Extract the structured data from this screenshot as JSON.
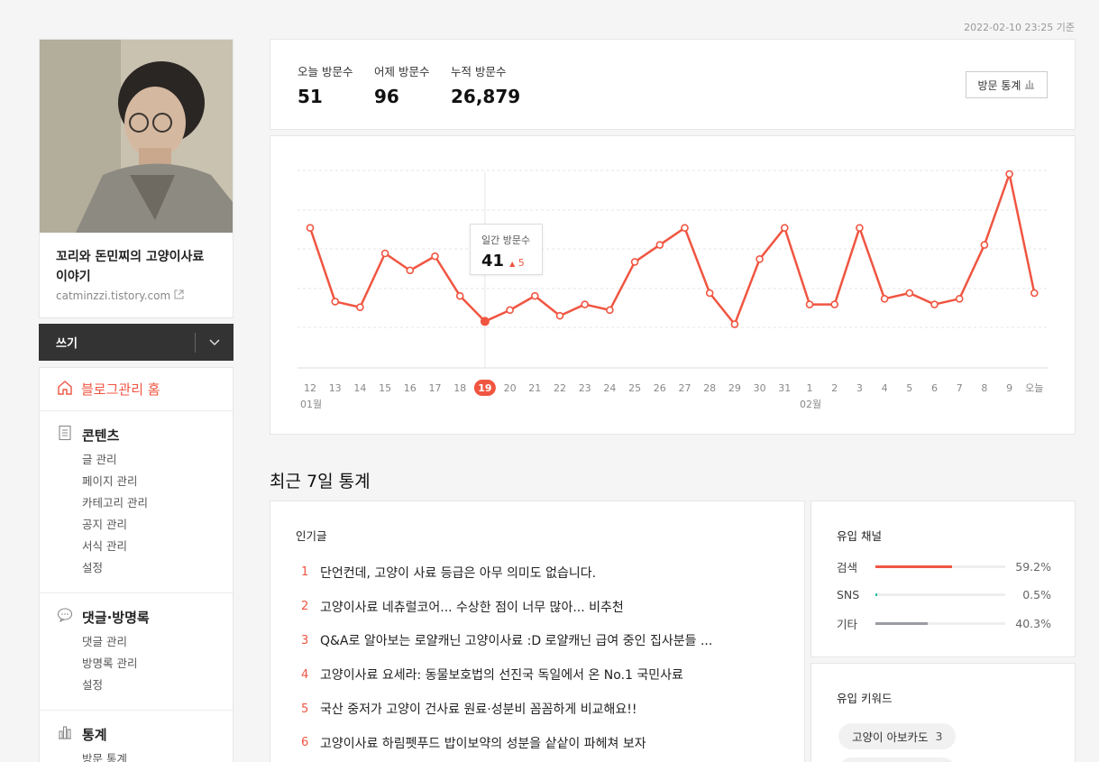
{
  "timestamp": "2022-02-10 23:25 기준",
  "profile": {
    "blog_title": "꼬리와 돈민찌의 고양이사료 이야기",
    "blog_url": "catminzzi.tistory.com"
  },
  "write": {
    "label": "쓰기"
  },
  "menu": {
    "home": "블로그관리 홈",
    "sections": [
      {
        "title": "콘텐츠",
        "icon": "document-icon",
        "items": [
          "글 관리",
          "페이지 관리",
          "카테고리 관리",
          "공지 관리",
          "서식 관리",
          "설정"
        ]
      },
      {
        "title": "댓글·방명록",
        "icon": "speech-bubble-icon",
        "items": [
          "댓글 관리",
          "방명록 관리",
          "설정"
        ]
      },
      {
        "title": "통계",
        "icon": "bar-chart-icon",
        "items": [
          "방문 통계"
        ]
      }
    ]
  },
  "stats": {
    "today_label": "오늘 방문수",
    "today_value": "51",
    "yesterday_label": "어제 방문수",
    "yesterday_value": "96",
    "total_label": "누적 방문수",
    "total_value": "26,879",
    "button_label": "방문 통계"
  },
  "chart_data": {
    "type": "line",
    "x": [
      "12",
      "13",
      "14",
      "15",
      "16",
      "17",
      "18",
      "19",
      "20",
      "21",
      "22",
      "23",
      "24",
      "25",
      "26",
      "27",
      "28",
      "29",
      "30",
      "31",
      "1",
      "2",
      "3",
      "4",
      "5",
      "6",
      "7",
      "8",
      "9",
      "오늘"
    ],
    "month_labels": [
      {
        "at": "12",
        "label": "01월"
      },
      {
        "at": "1",
        "label": "02월"
      }
    ],
    "series": [
      {
        "values": [
          74,
          48,
          46,
          65,
          59,
          64,
          50,
          41,
          45,
          50,
          43,
          47,
          45,
          62,
          68,
          74,
          51,
          40,
          63,
          74,
          47,
          47,
          74,
          49,
          51,
          47,
          49,
          68,
          93,
          51
        ]
      }
    ],
    "highlight_index": 7,
    "color": "#f05541",
    "grid": true
  },
  "tooltip": {
    "label": "일간 방문수",
    "value": "41",
    "delta": "5"
  },
  "recent": {
    "title": "최근 7일 통계",
    "popular_title": "인기글",
    "popular": [
      {
        "rank": "1",
        "text": "단언컨데, 고양이 사료 등급은 아무 의미도 없습니다."
      },
      {
        "rank": "2",
        "text": "고양이사료 네츄럴코어... 수상한 점이 너무 많아... 비추천"
      },
      {
        "rank": "3",
        "text": "Q&A로 알아보는 로얄캐닌 고양이사료 :D 로얄캐닌 급여 중인 집사분들 ..."
      },
      {
        "rank": "4",
        "text": "고양이사료 요세라: 동물보호법의 선진국 독일에서 온 No.1 국민사료"
      },
      {
        "rank": "5",
        "text": "국산 중저가 고양이 건사료 원료·성분비 꼼꼼하게 비교해요!!"
      },
      {
        "rank": "6",
        "text": "고양이사료 하림펫푸드 밥이보약의 성분을 샅샅이 파헤쳐 보자"
      }
    ],
    "inflow_title": "유입 채널",
    "inflow": [
      {
        "name": "검색",
        "pct": "59.2%",
        "ratio": 0.592,
        "color": "#f05541"
      },
      {
        "name": "SNS",
        "pct": "0.5%",
        "ratio": 0.005,
        "color": "#1fc1a4"
      },
      {
        "name": "기타",
        "pct": "40.3%",
        "ratio": 0.403,
        "color": "#9a9ca4"
      }
    ],
    "keyword_title": "유입 키워드",
    "keywords": [
      {
        "text": "고양이 아보카도",
        "count": "3"
      }
    ]
  }
}
